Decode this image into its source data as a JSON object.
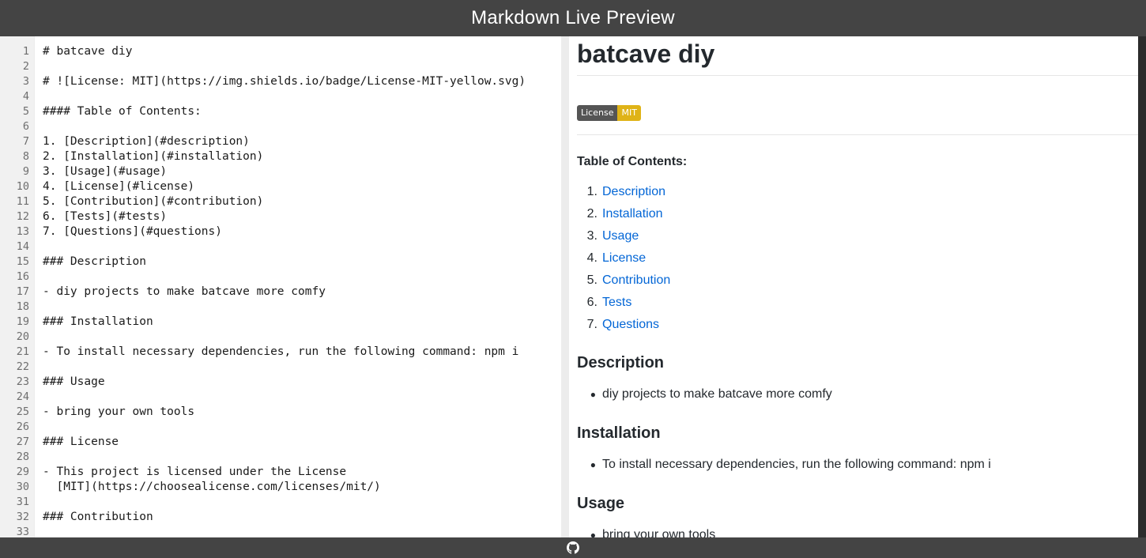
{
  "header": {
    "title": "Markdown Live Preview"
  },
  "editor": {
    "lines": [
      "# batcave diy",
      "",
      "# ![License: MIT](https://img.shields.io/badge/License-MIT-yellow.svg)",
      "",
      "#### Table of Contents:",
      "",
      "1. [Description](#description)",
      "2. [Installation](#installation)",
      "3. [Usage](#usage)",
      "4. [License](#license)",
      "5. [Contribution](#contribution)",
      "6. [Tests](#tests)",
      "7. [Questions](#questions)",
      "",
      "### Description",
      "",
      "- diy projects to make batcave more comfy",
      "",
      "### Installation",
      "",
      "- To install necessary dependencies, run the following command: npm i",
      "",
      "### Usage",
      "",
      "- bring your own tools",
      "",
      "### License",
      "",
      "- This project is licensed under the License",
      "  [MIT](https://choosealicense.com/licenses/mit/)",
      "",
      "### Contribution",
      ""
    ]
  },
  "preview": {
    "title": "batcave diy",
    "badge": {
      "label": "License",
      "value": "MIT"
    },
    "toc_heading": "Table of Contents:",
    "toc": [
      {
        "num": "1.",
        "label": "Description"
      },
      {
        "num": "2.",
        "label": "Installation"
      },
      {
        "num": "3.",
        "label": "Usage"
      },
      {
        "num": "4.",
        "label": "License"
      },
      {
        "num": "5.",
        "label": "Contribution"
      },
      {
        "num": "6.",
        "label": "Tests"
      },
      {
        "num": "7.",
        "label": "Questions"
      }
    ],
    "sections": [
      {
        "heading": "Description",
        "bullet": "diy projects to make batcave more comfy"
      },
      {
        "heading": "Installation",
        "bullet": "To install necessary dependencies, run the following command: npm i"
      },
      {
        "heading": "Usage",
        "bullet": "bring your own tools"
      }
    ]
  },
  "footer": {
    "icon": "github-icon"
  },
  "colors": {
    "header_bg": "#444444",
    "link": "#0366d6",
    "badge_label_bg": "#555555",
    "badge_value_bg": "#dfb317"
  }
}
